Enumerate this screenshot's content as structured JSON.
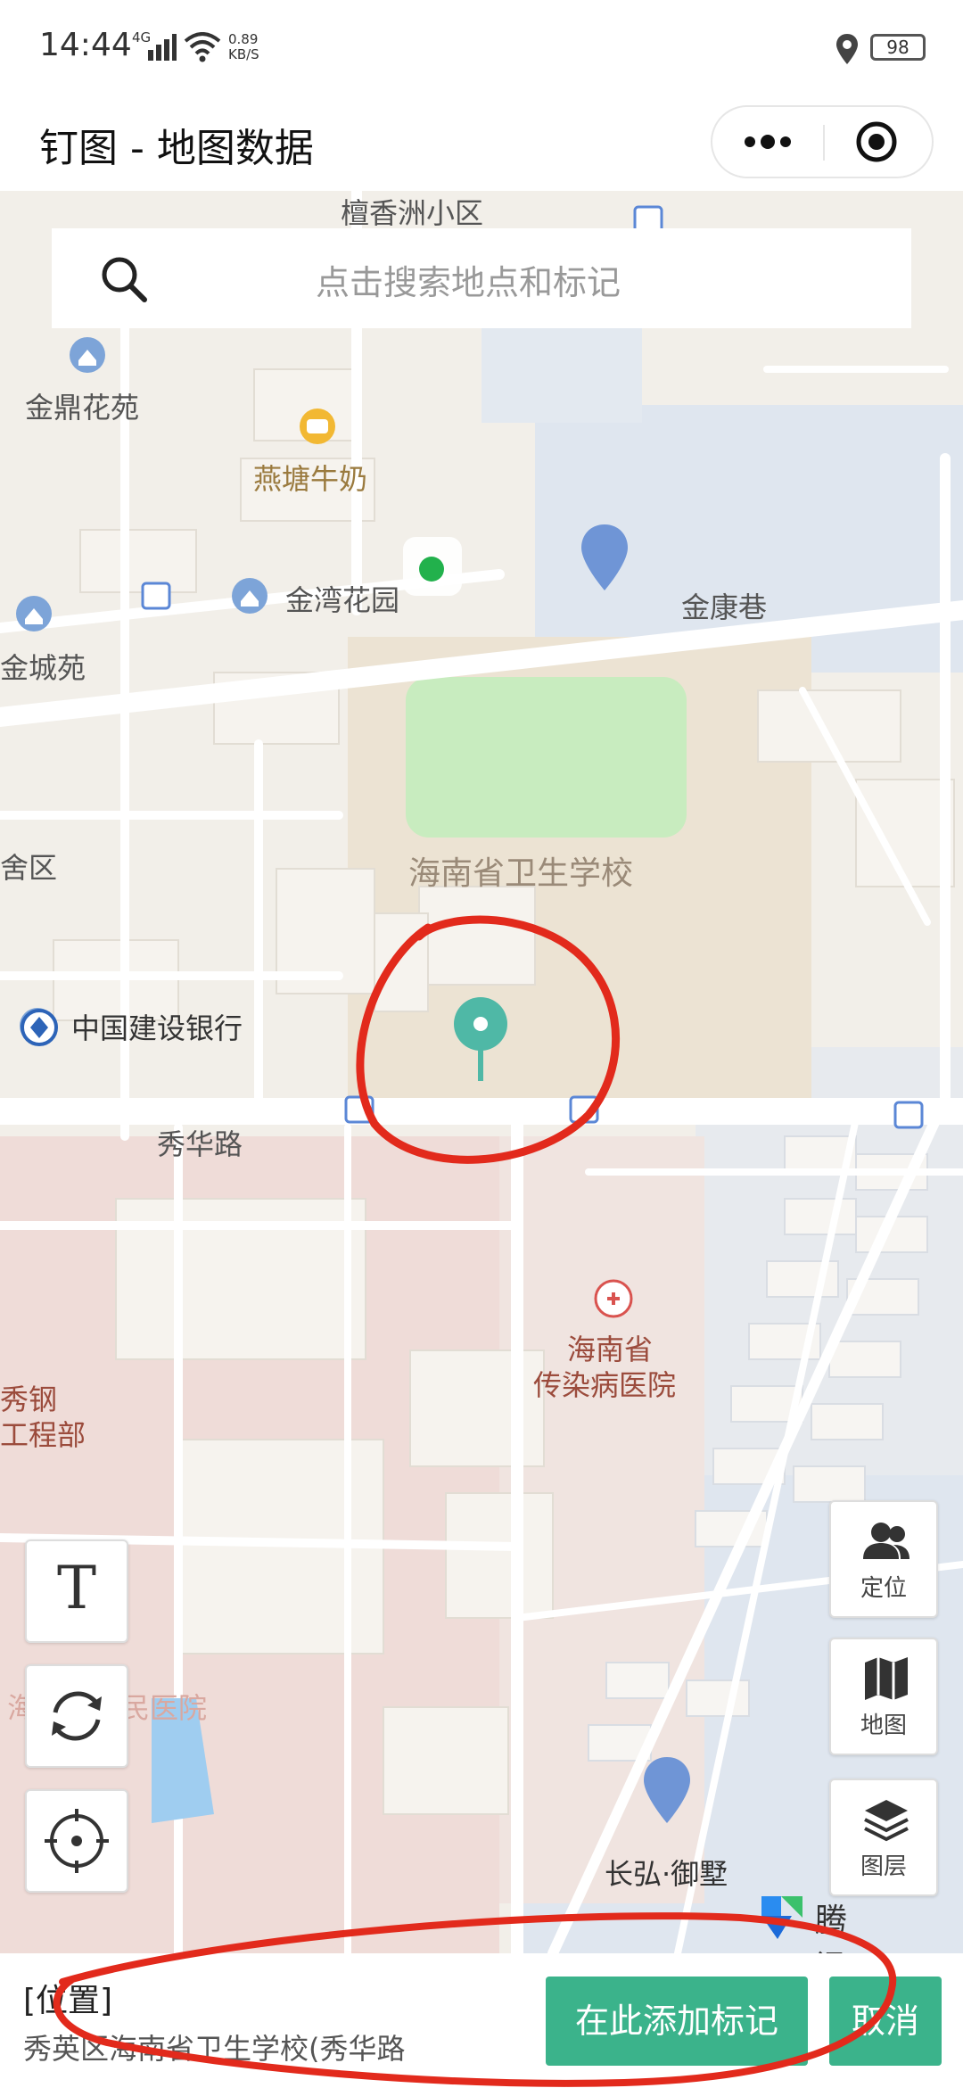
{
  "status_bar": {
    "time": "14:44",
    "network": "4G",
    "speed_value": "0.89",
    "speed_unit": "KB/S",
    "battery": "98"
  },
  "header": {
    "title": "钉图 - 地图数据"
  },
  "search": {
    "placeholder": "点击搜索地点和标记"
  },
  "map": {
    "labels": {
      "tanxiangzhou": "檀香洲小区",
      "jinding": "金鼎花苑",
      "yantang": "燕塘牛奶",
      "jinwan": "金湾花园",
      "jinkang": "金康巷",
      "jincheng": "金城苑",
      "campus": "海南省卫生学校",
      "shequ": "舍区",
      "ccb": "中国建设银行",
      "xiuhua_road": "秀华路",
      "hospital_line1": "海南省",
      "hospital_line2": "传染病医院",
      "xiugang_line1": "秀钢",
      "xiugang_line2": "工程部",
      "people_hospital": "海口市人民医院",
      "changhong": "长弘·御墅"
    },
    "controls": {
      "locate": "定位",
      "map": "地图",
      "layers": "图层"
    },
    "brand": "腾讯地图",
    "colors": {
      "accent": "#3bb38b",
      "marker": "#4fb8a6",
      "blue_marker": "#6f95d6",
      "annotation": "#e22a1c"
    }
  },
  "bottom_panel": {
    "label": "[位置]",
    "address": "秀英区海南省卫生学校(秀华路",
    "add_button": "在此添加标记",
    "cancel_button": "取消"
  }
}
